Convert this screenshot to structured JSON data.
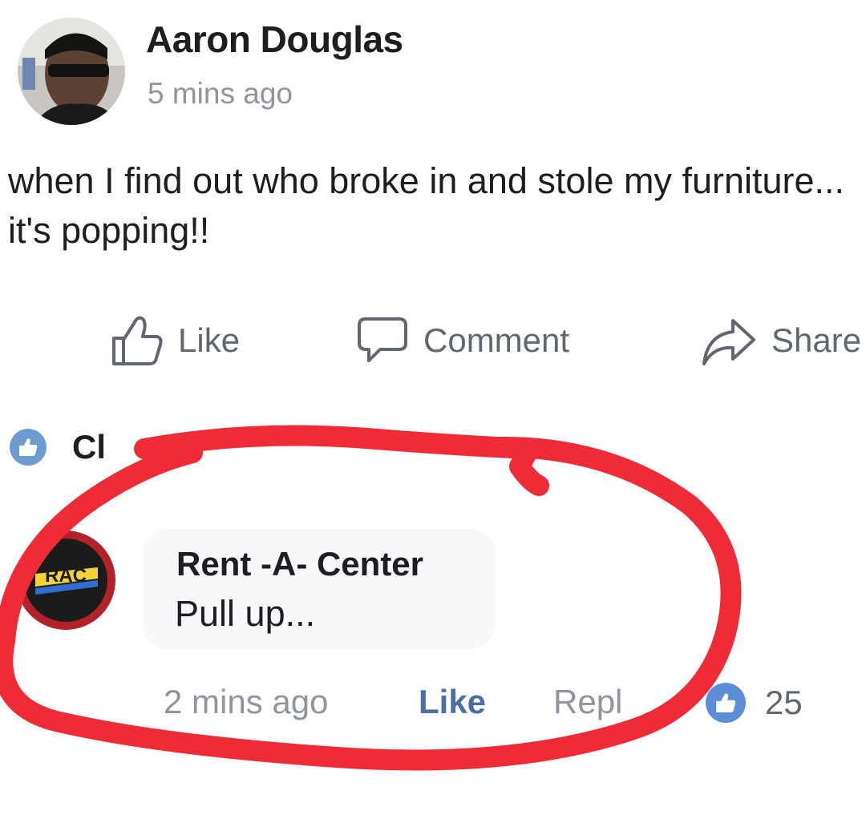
{
  "post": {
    "author": "Aaron Douglas",
    "time": "5 mins ago",
    "text": "when I find out who broke in and stole my furniture... it's popping!!",
    "avatar_icon": "user-avatar-icon"
  },
  "actions": {
    "like": "Like",
    "comment": "Comment",
    "share": "Share"
  },
  "reactions": {
    "label": "Cl"
  },
  "comment": {
    "author": "Rent -A- Center",
    "text": "Pull up...",
    "logo_text": "RAC",
    "time": "2 mins ago",
    "like": "Like",
    "reply": "Repl",
    "reaction_count": "25"
  },
  "colors": {
    "like_blue": "#4b6fa4",
    "badge_blue": "#5b8ed6",
    "annotation_red": "#ee2b36",
    "muted_gray": "#90949c"
  }
}
